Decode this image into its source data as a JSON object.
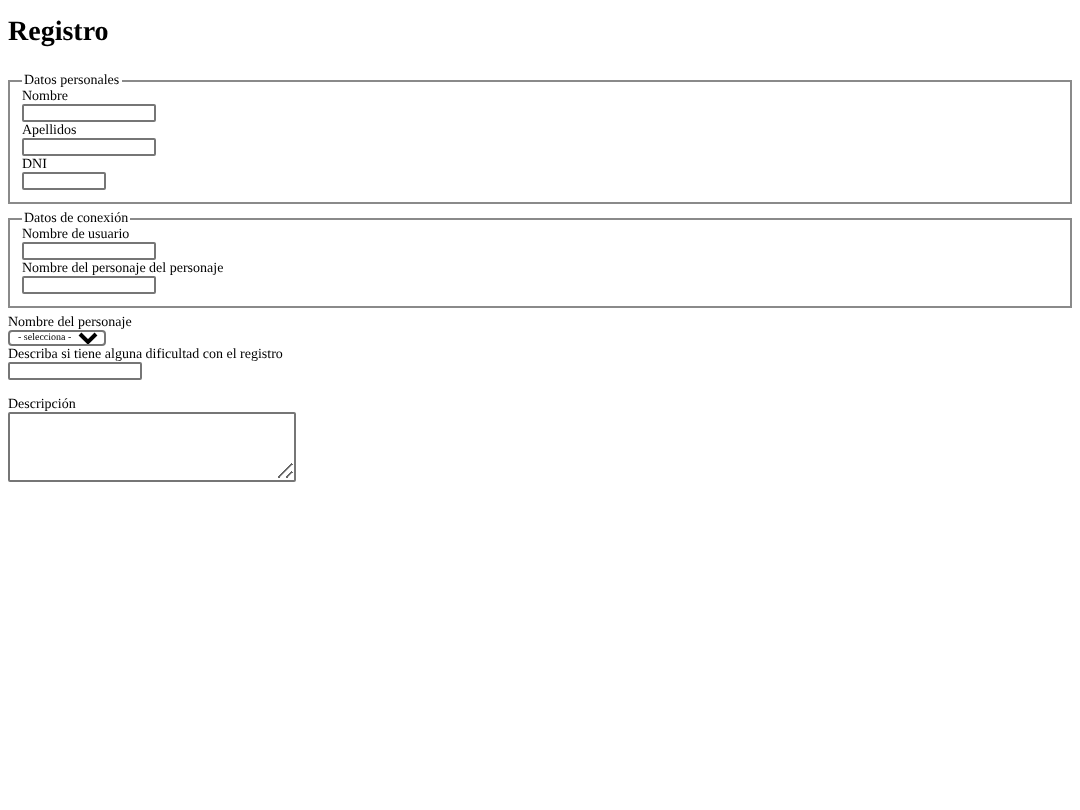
{
  "title": "Registro",
  "fieldsets": [
    {
      "legend": "Datos personales",
      "fields": [
        {
          "label": "Nombre",
          "kind": "text"
        },
        {
          "label": "Apellidos",
          "kind": "text"
        },
        {
          "label": "DNI",
          "kind": "short"
        }
      ]
    },
    {
      "legend": "Datos de conexión",
      "fields": [
        {
          "label": "Nombre de usuario",
          "kind": "text"
        },
        {
          "label": "Nombre del personaje del personaje",
          "kind": "text"
        }
      ]
    }
  ],
  "fields": [
    {
      "label": "Nombre del personaje",
      "kind": "select",
      "value": "- selecciona -"
    },
    {
      "label": "Describa si tiene alguna dificultad con el registro",
      "kind": "text"
    },
    {
      "label": "Descripción",
      "kind": "textarea"
    }
  ]
}
